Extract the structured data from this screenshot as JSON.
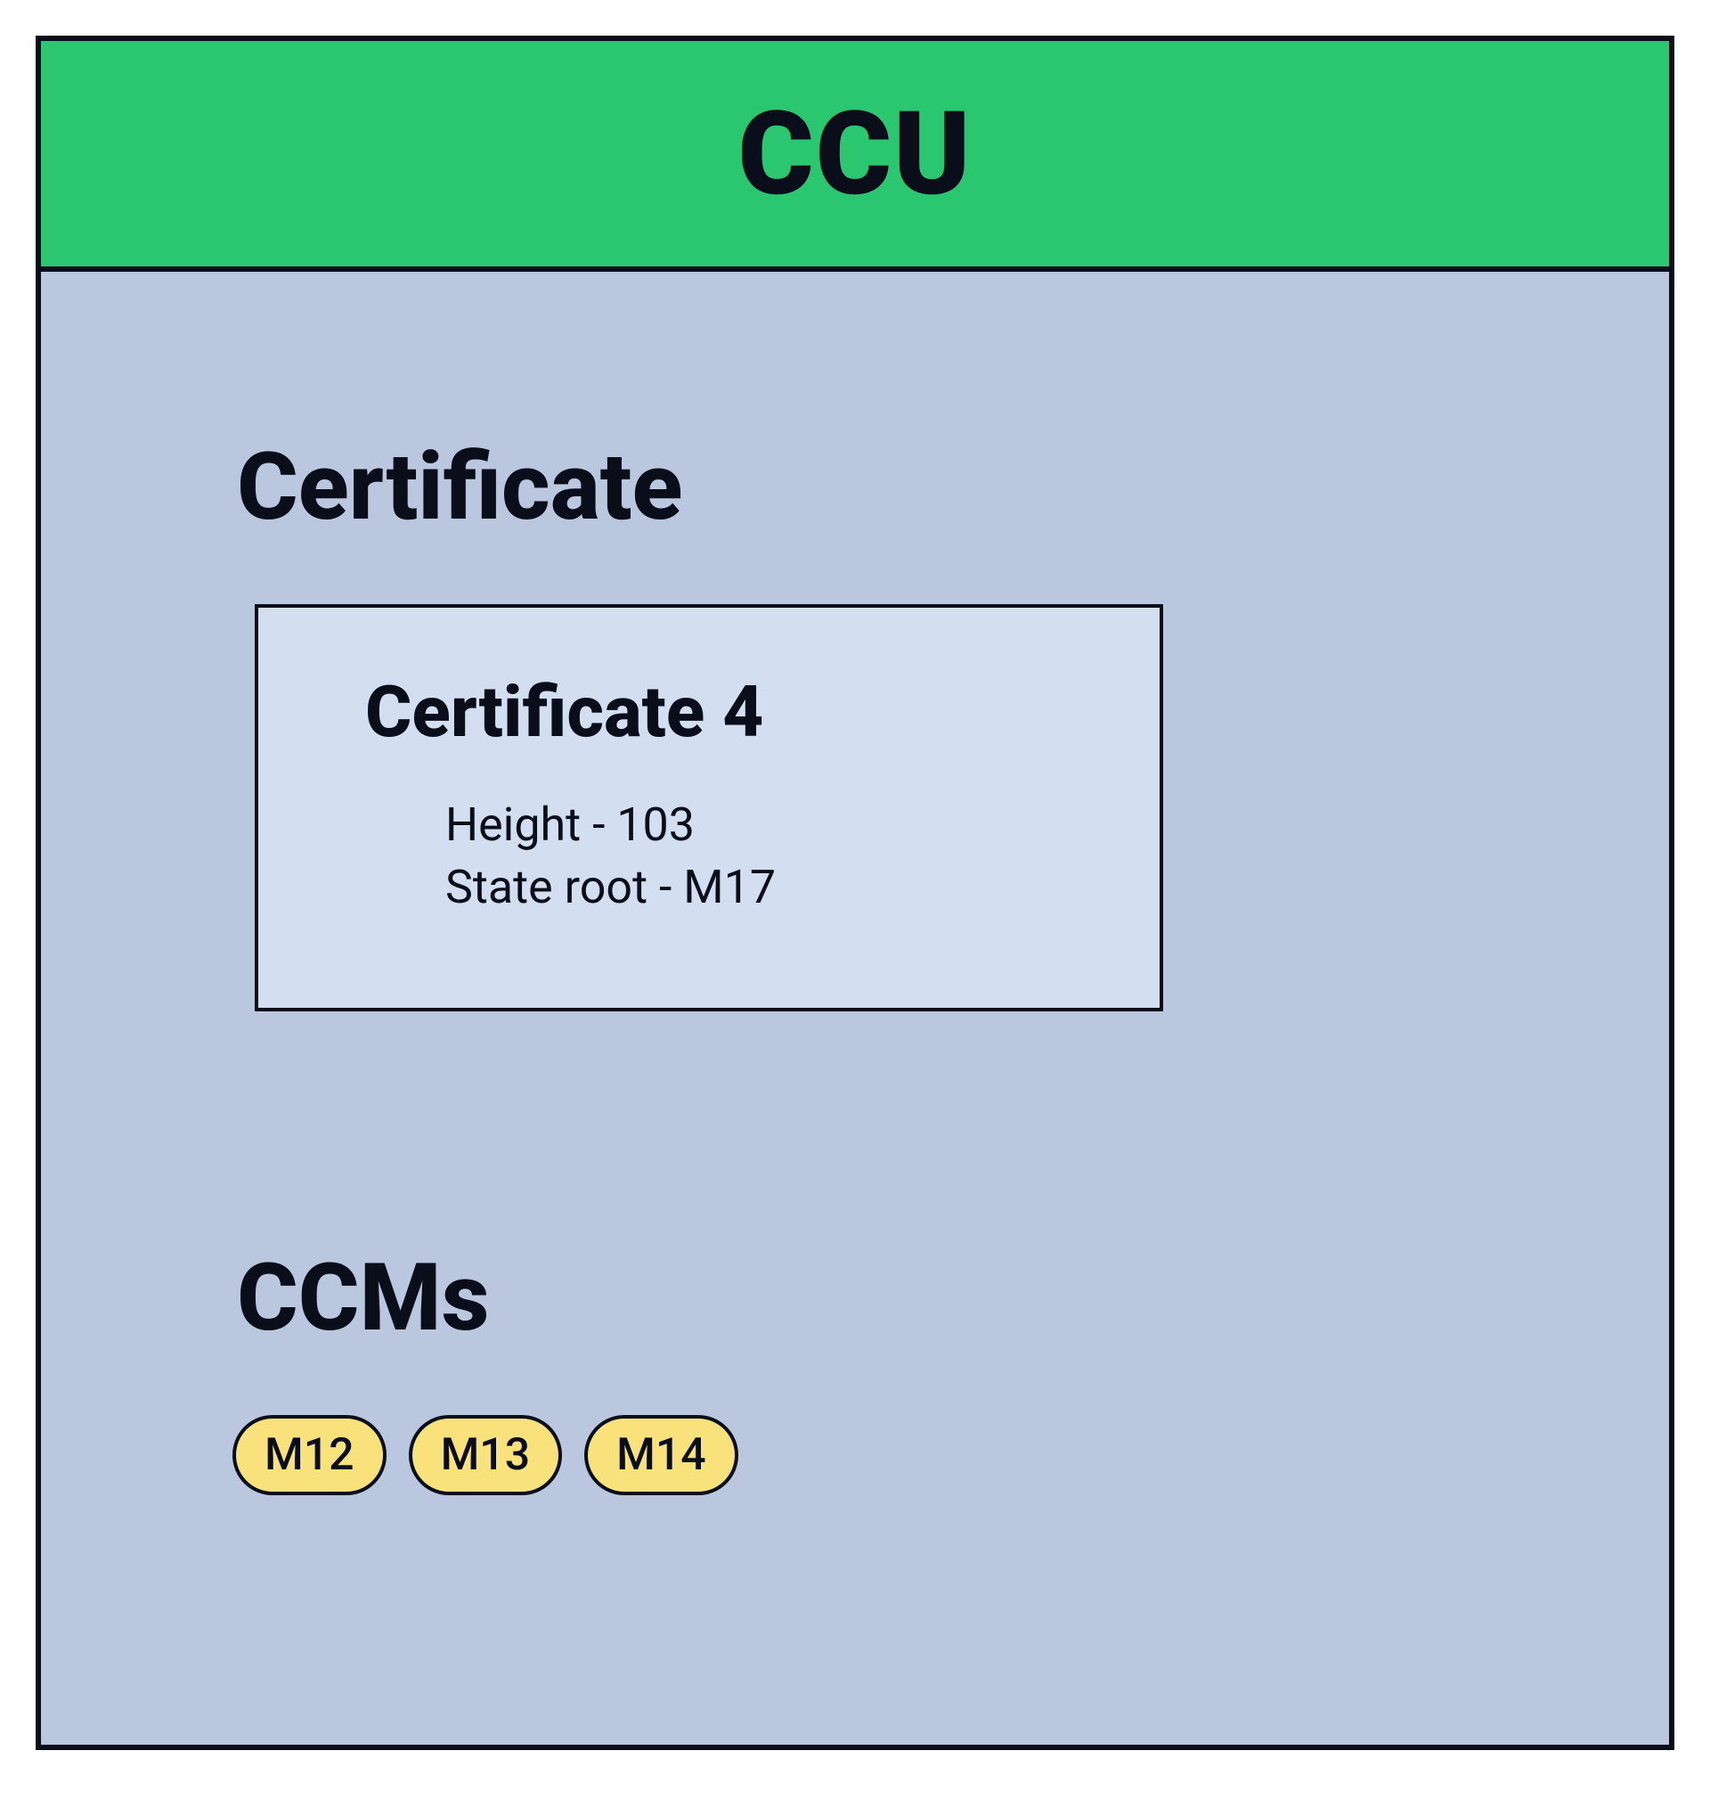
{
  "header": {
    "title": "CCU"
  },
  "certificate": {
    "section_title": "Certificate",
    "name": "Certificate 4",
    "height_line": "Height - 103",
    "state_root_line": "State root - M17"
  },
  "ccms": {
    "section_title": "CCMs",
    "items": [
      "M12",
      "M13",
      "M14"
    ]
  },
  "colors": {
    "header_bg": "#2ac770",
    "body_bg": "#bac7de",
    "cert_box_bg": "#d3def0",
    "pill_bg": "#f9e27b",
    "border": "#0a0e1a"
  }
}
